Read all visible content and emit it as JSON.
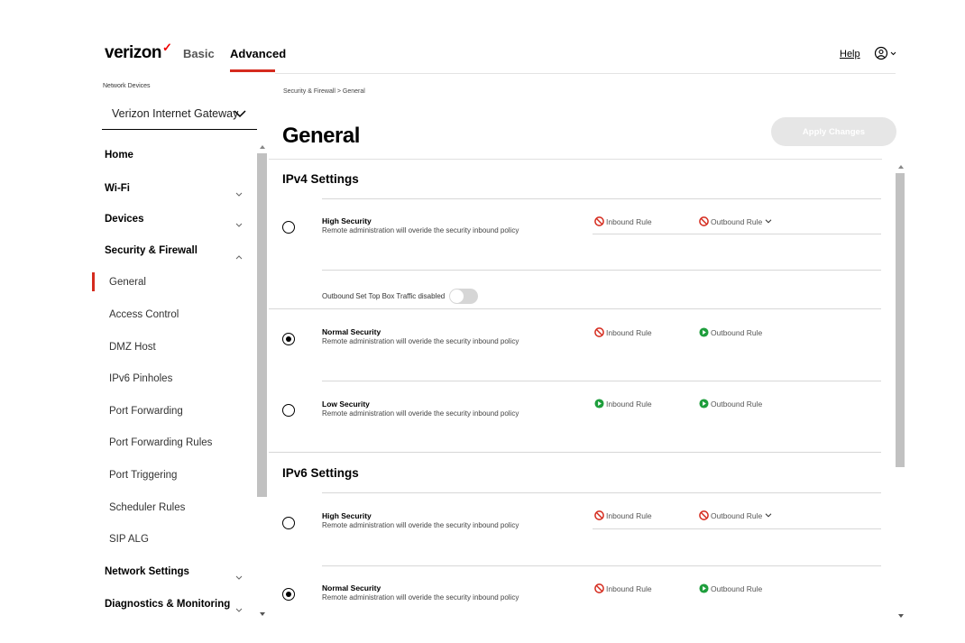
{
  "header": {
    "logo": "verizon",
    "logo_mark": "✓",
    "nav_basic": "Basic",
    "nav_advanced": "Advanced",
    "help": "Help"
  },
  "sidebar": {
    "device_label": "Network Devices",
    "device_selected": "Verizon Internet Gateway",
    "items": [
      {
        "label": "Home"
      },
      {
        "label": "Wi-Fi"
      },
      {
        "label": "Devices"
      },
      {
        "label": "Security & Firewall"
      },
      {
        "label": "General"
      },
      {
        "label": "Access Control"
      },
      {
        "label": "DMZ Host"
      },
      {
        "label": "IPv6 Pinholes"
      },
      {
        "label": "Port Forwarding"
      },
      {
        "label": "Port Forwarding Rules"
      },
      {
        "label": "Port Triggering"
      },
      {
        "label": "Scheduler Rules"
      },
      {
        "label": "SIP ALG"
      },
      {
        "label": "Network Settings"
      },
      {
        "label": "Diagnostics & Monitoring"
      }
    ]
  },
  "main": {
    "breadcrumb": "Security & Firewall  >  General",
    "title": "General",
    "apply_button": "Apply Changes",
    "ipv4": {
      "title": "IPv4 Settings",
      "options": [
        {
          "title": "High Security",
          "desc": "Remote administration will overide the security inbound policy",
          "inbound": "Inbound Rule",
          "outbound": "Outbound Rule"
        },
        {
          "title": "Normal Security",
          "desc": "Remote administration will overide the security inbound policy",
          "inbound": "Inbound Rule",
          "outbound": "Outbound Rule"
        },
        {
          "title": "Low Security",
          "desc": "Remote administration will overide the security inbound policy",
          "inbound": "Inbound Rule",
          "outbound": "Outbound Rule"
        }
      ],
      "toggle_label": "Outbound Set Top Box Traffic disabled"
    },
    "ipv6": {
      "title": "IPv6 Settings",
      "options": [
        {
          "title": "High Security",
          "desc": "Remote administration will overide the security inbound policy",
          "inbound": "Inbound Rule",
          "outbound": "Outbound Rule"
        },
        {
          "title": "Normal Security",
          "desc": "Remote administration will overide the security inbound policy",
          "inbound": "Inbound Rule",
          "outbound": "Outbound Rule"
        }
      ]
    }
  },
  "colors": {
    "accent": "#d52b1e",
    "blocked": "#d52b1e",
    "allowed": "#1e9e3c"
  }
}
